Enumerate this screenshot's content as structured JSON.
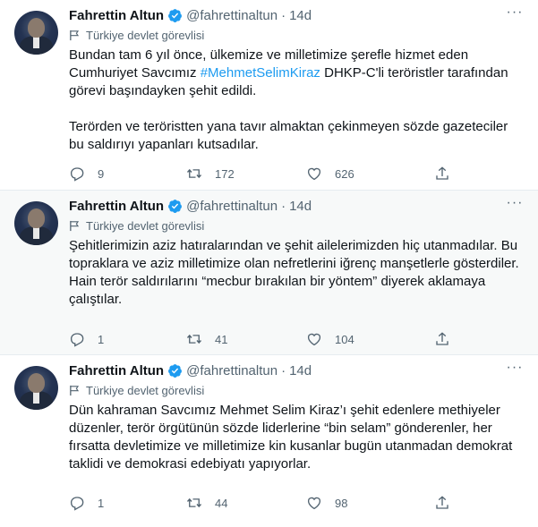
{
  "tweets": [
    {
      "name": "Fahrettin Altun",
      "handle": "@fahrettinaltun",
      "separator": "·",
      "time": "14d",
      "label": "Türkiye devlet görevlisi",
      "text_before": "Bundan tam 6 yıl önce, ülkemize ve milletimize şerefle hizmet eden\nCumhuriyet Savcımız ",
      "hashtag": "#MehmetSelimKiraz",
      "text_after": " DHKP-C'li teröristler tarafından\ngörevi başındayken şehit edildi.\n\nTerörden ve teröristten yana tavır almaktan çekinmeyen sözde gazeteciler\nbu saldırıyı yapanları kutsadılar.",
      "replies": "9",
      "retweets": "172",
      "likes": "626"
    },
    {
      "name": "Fahrettin Altun",
      "handle": "@fahrettinaltun",
      "separator": "·",
      "time": "14d",
      "label": "Türkiye devlet görevlisi",
      "text": "Şehitlerimizin aziz hatıralarından ve şehit ailelerimizden hiç utanmadılar. Bu\ntopraklara ve aziz milletimize olan nefretlerini iğrenç manşetlerle gösterdiler.\nHain terör saldırılarını “mecbur bırakılan bir yöntem” diyerek aklamaya\nçalıştılar.",
      "replies": "1",
      "retweets": "41",
      "likes": "104"
    },
    {
      "name": "Fahrettin Altun",
      "handle": "@fahrettinaltun",
      "separator": "·",
      "time": "14d",
      "label": "Türkiye devlet görevlisi",
      "text": "Dün kahraman Savcımız Mehmet Selim Kiraz’ı şehit edenlere methiyeler\ndüzenler, terör örgütünün sözde liderlerine “bin selam” gönderenler, her\nfırsatta devletimize ve milletimize kin kusanlar bugün utanmadan demokrat\ntaklidi ve demokrasi edebiyatı yapıyorlar.",
      "replies": "1",
      "retweets": "44",
      "likes": "98"
    }
  ],
  "colors": {
    "accent": "#1d9bf0",
    "muted": "#536471",
    "text": "#0f1419",
    "verified": "#1d9bf0"
  },
  "icons": [
    "verified-badge-icon",
    "more-icon",
    "flag-icon",
    "reply-icon",
    "retweet-icon",
    "like-icon",
    "share-icon"
  ]
}
